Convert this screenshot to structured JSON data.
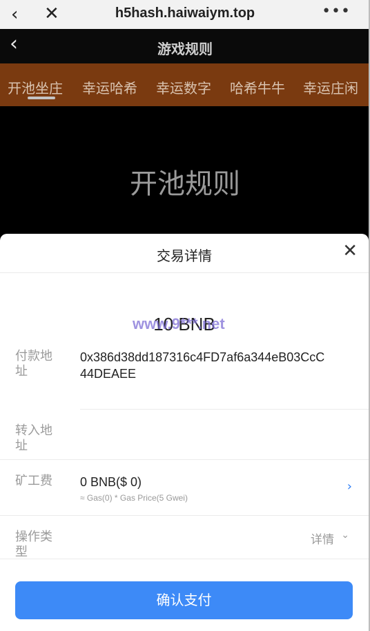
{
  "browser": {
    "back_icon": "‹",
    "close_icon": "✕",
    "url": "h5hash.haiwaiym.top",
    "more_icon": "•••"
  },
  "header": {
    "back_icon": "‹",
    "title": "游戏规则"
  },
  "tabs": [
    {
      "label": "开池坐庄"
    },
    {
      "label": "幸运哈希"
    },
    {
      "label": "幸运数字"
    },
    {
      "label": "哈希牛牛"
    },
    {
      "label": "幸运庄闲"
    }
  ],
  "content": {
    "rules_title": "开池规则"
  },
  "sheet": {
    "title": "交易详情",
    "close_icon": "✕",
    "amount": "10 BNB",
    "watermark": "www.9***.net",
    "payer_label_line1": "付款地",
    "payer_label_line2": "址",
    "payer_address_line1": "0x386d38dd187316c4FD7af6a344eB03CcC",
    "payer_address_line2": "44DEAEE",
    "to_label_line1": "转入地",
    "to_label_line2": "址",
    "fee_label": "矿工费",
    "fee_value": "0 BNB($ 0)",
    "fee_detail": "≈ Gas(0) * Gas Price(5 Gwei)",
    "fee_chevron": "›",
    "op_label_line1": "操作类",
    "op_label_line2": "型",
    "op_detail": "详情",
    "op_chevron": "⌄",
    "confirm_label": "确认支付"
  },
  "colors": {
    "tab_bg": "#7a3a10",
    "confirm_bg": "#3d8af7",
    "watermark": "#7f6fd6"
  }
}
